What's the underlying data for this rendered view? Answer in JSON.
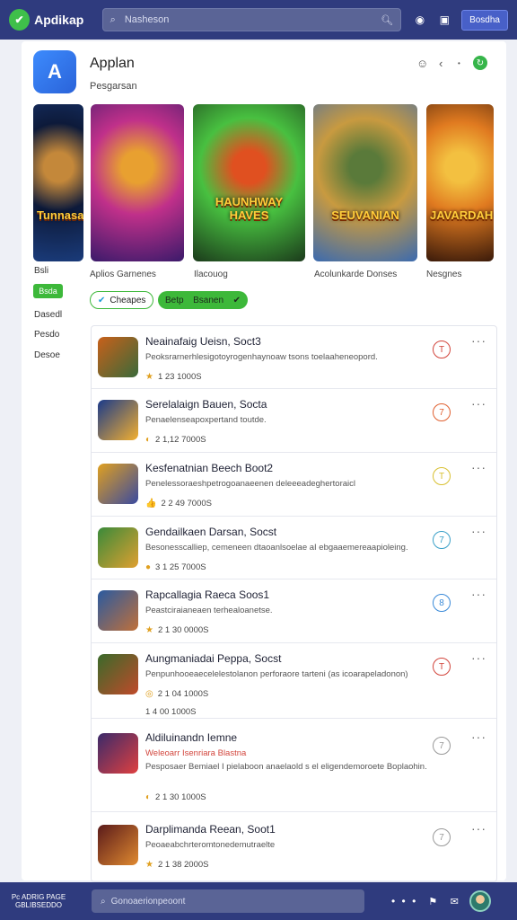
{
  "topbar": {
    "brand": "Apdikap",
    "search_placeholder": "Nasheson",
    "button_label": "Bosdha"
  },
  "app": {
    "title": "Applan",
    "subtitle": "Pesgarsan"
  },
  "banners": [
    {
      "title": "Tunnasai",
      "colors": [
        "#1a3b7a",
        "#0d1a3a",
        "#c4883a"
      ]
    },
    {
      "title": "",
      "colors": [
        "#3a1a6a",
        "#c0308a",
        "#e8a030"
      ]
    },
    {
      "title": "HAUNHWAY HAVES",
      "colors": [
        "#1b3a1b",
        "#48c040",
        "#e05020"
      ]
    },
    {
      "title": "SEUVANIAN",
      "colors": [
        "#3a6ab0",
        "#c89a40",
        "#5a7a3a"
      ]
    },
    {
      "title": "JAVARDAH",
      "colors": [
        "#3a1a0a",
        "#e07a20",
        "#f3c040"
      ]
    }
  ],
  "banner_captions": [
    "Aplios Garnenes",
    "Ilacouog",
    "Acolunkarde Donses",
    "Nesgnes"
  ],
  "sidebar": {
    "items": [
      "Bsli",
      "Bsda",
      "Dasedl",
      "Pesdo",
      "Desoe"
    ]
  },
  "chips": {
    "outline": "Cheapes",
    "tab1": "Betp",
    "tab2": "Bsanen"
  },
  "rows": [
    {
      "title": "Neainafaig Ueisn, Soct3",
      "desc": "Peoksrarnerhlesigotoyrogenhaynoaw tsons toelaaheneopord.",
      "meta": "1 23 1000S",
      "meta_icon": "★",
      "badge": "T",
      "badge_color": "#d2453c",
      "thumb": [
        "#c8601a",
        "#3a6a3a"
      ]
    },
    {
      "title": "Serelalaign Bauen, Socta",
      "desc": "Penaelenseapoxpertand toutde.",
      "meta": "2 1,12 7000S",
      "meta_icon": "◐",
      "badge": "7",
      "badge_color": "#e06030",
      "thumb": [
        "#1a3a8a",
        "#f3b030"
      ]
    },
    {
      "title": "Kesfenatnian Beech Boot2",
      "desc": "Penelessoraeshpetrogoanaeenen deleeeadeghertoraicl",
      "meta": "2 2 49 7000S",
      "meta_icon": "👍",
      "badge": "T",
      "badge_color": "#d8c030",
      "thumb": [
        "#e0a020",
        "#3a4aa0"
      ]
    },
    {
      "title": "Gendailkaen Darsan, Socst",
      "desc": "Besonesscalliep, cemeneen dtaoanlsoelae aI ebgaaemereaapioleing.",
      "meta": "3 1 25 7000S",
      "meta_icon": "●",
      "badge": "7",
      "badge_color": "#3aa0c8",
      "thumb": [
        "#3a8a3a",
        "#e0a030"
      ]
    },
    {
      "title": "Rapcallagia Raeca Soos1",
      "desc": "Peastciraianeaen terhealoanetse.",
      "meta": "2 1 30 0000S",
      "meta_icon": "★",
      "badge": "8",
      "badge_color": "#3a8ad8",
      "thumb": [
        "#2a5aa0",
        "#c0703a"
      ]
    },
    {
      "title": "Aungmaniadai Peppa, Socst",
      "desc": "Penpunhooeaecelelestolanon perforaore tarteni (as icoarapeladonon)",
      "meta": "2 1 04 1000S",
      "meta_icon": "◎",
      "meta2": "1 4 00 1000S",
      "badge": "T",
      "badge_color": "#d2453c",
      "thumb": [
        "#3a6a2a",
        "#c04a2a"
      ]
    },
    {
      "title": "Aldiluinandn Iemne",
      "desc_red": "Weleoarr Isenriara Blastna",
      "desc": "Pesposaer Bemiael I pielaboon anaelaold s el eligendemoroete Boplaohin.",
      "meta": "2 1 30 1000S",
      "meta_icon": "◐",
      "badge": "7",
      "badge_color": "#999999",
      "thumb": [
        "#3a2a6a",
        "#e04040"
      ]
    },
    {
      "title": "Darplimanda Reean, Soot1",
      "desc": "Peoaeabchrteromtonedemutraelte",
      "meta": "2 1 38 2000S",
      "meta_icon": "★",
      "badge": "7",
      "badge_color": "#999999",
      "thumb": [
        "#5a1a1a",
        "#e08a30"
      ]
    }
  ],
  "footer": {
    "brand": "Pc ADRIG PAGE\nGBLIBSEDDO",
    "input_placeholder": "Gonoaerionpeoont"
  }
}
